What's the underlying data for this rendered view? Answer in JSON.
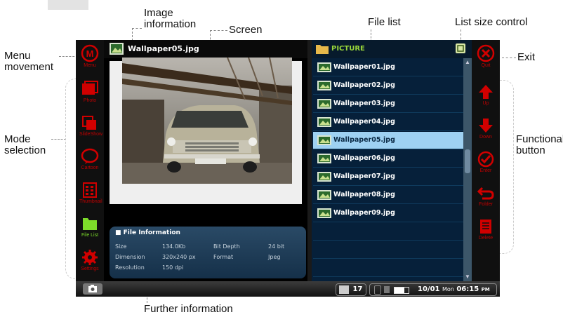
{
  "callouts": {
    "image_information": "Image\ninformation",
    "screen": "Screen",
    "file_list": "File list",
    "list_size_control": "List size control",
    "menu_movement": "Menu\nmovement",
    "exit": "Exit",
    "mode_selection": "Mode\nselection",
    "functional_button": "Functional\nbutton",
    "further_information": "Further information"
  },
  "left_menu": {
    "menu": "Menu",
    "items": [
      {
        "label": "Photo",
        "icon": "photo-icon",
        "active": false
      },
      {
        "label": "SlideShow",
        "icon": "slideshow-icon",
        "active": false
      },
      {
        "label": "Cartoon",
        "icon": "cartoon-icon",
        "active": false
      },
      {
        "label": "Thumbnail",
        "icon": "thumbnail-icon",
        "active": false
      },
      {
        "label": "File List",
        "icon": "folder-icon",
        "active": true
      },
      {
        "label": "Settings",
        "icon": "gear-icon",
        "active": false
      }
    ]
  },
  "viewer": {
    "title": "Wallpaper05.jpg"
  },
  "file_info": {
    "header": "File Information",
    "rows": [
      {
        "label": "Size",
        "value": "134.0Kb",
        "label2": "Bit Depth",
        "value2": "24 bit"
      },
      {
        "label": "Dimension",
        "value": "320x240 px",
        "label2": "Format",
        "value2": "Jpeg"
      },
      {
        "label": "Resolution",
        "value": "150 dpi"
      }
    ]
  },
  "file_list": {
    "folder": "PICTURE",
    "items": [
      "Wallpaper01.jpg",
      "Wallpaper02.jpg",
      "Wallpaper03.jpg",
      "Wallpaper04.jpg",
      "Wallpaper05.jpg",
      "Wallpaper06.jpg",
      "Wallpaper07.jpg",
      "Wallpaper08.jpg",
      "Wallpaper09.jpg"
    ],
    "selected_index": 4
  },
  "right_menu": {
    "quit": "Quit",
    "items": [
      {
        "label": "Up",
        "icon": "up-arrow-icon"
      },
      {
        "label": "Down",
        "icon": "down-arrow-icon"
      },
      {
        "label": "Enter",
        "icon": "enter-icon"
      },
      {
        "label": "Folder",
        "icon": "back-folder-icon"
      },
      {
        "label": "Delete",
        "icon": "delete-icon"
      }
    ]
  },
  "statusbar": {
    "volume": "17",
    "date": "10/01",
    "day": "Mon",
    "time": "06:15",
    "ampm": "PM"
  },
  "colors": {
    "accent_red": "#d10000",
    "list_bg": "#06203a",
    "selected_row": "#9ed1f2",
    "folder_green": "#9ad83b"
  }
}
